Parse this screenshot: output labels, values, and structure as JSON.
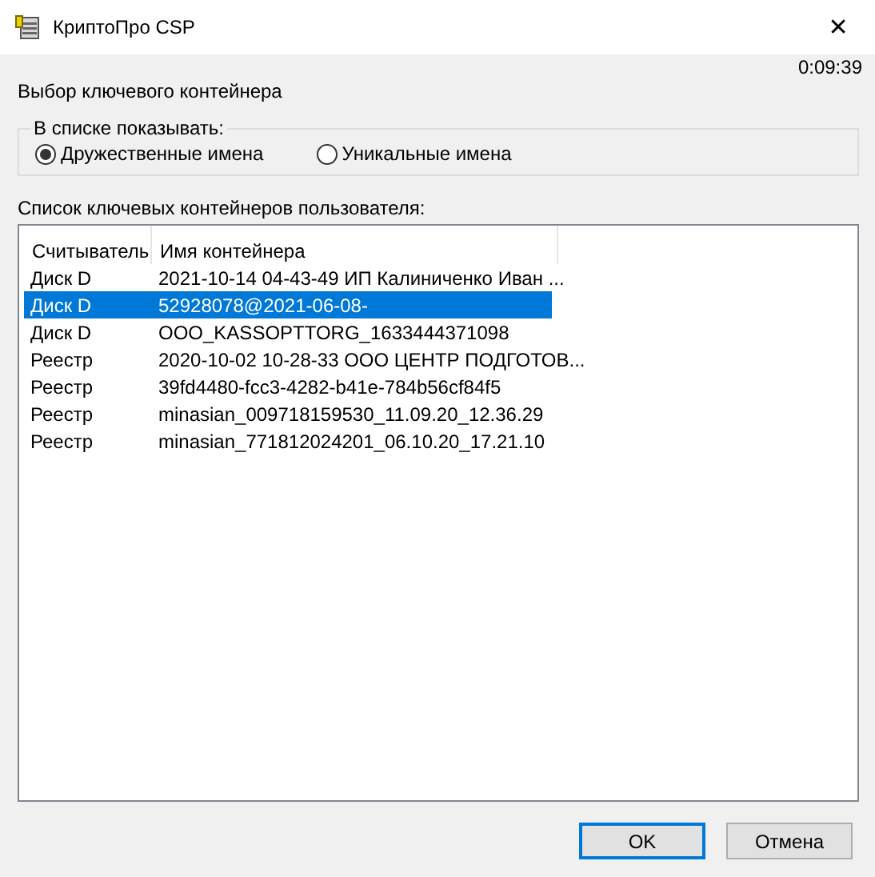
{
  "window": {
    "title": "КриптоПро CSP",
    "close": "✕"
  },
  "timer": "0:09:39",
  "heading": "Выбор ключевого контейнера",
  "show_group": {
    "label": "В списке показывать:",
    "options": [
      {
        "label": "Дружественные имена",
        "selected": true
      },
      {
        "label": "Уникальные имена",
        "selected": false
      }
    ]
  },
  "list_label": "Список ключевых контейнеров пользователя:",
  "table": {
    "columns": [
      "Считыватель",
      "Имя контейнера"
    ],
    "rows": [
      {
        "reader": "Диск D",
        "name": "2021-10-14 04-43-49 ИП Калиниченко Иван ...",
        "selected": false
      },
      {
        "reader": "Диск D",
        "name": "52928078@2021-06-08-",
        "selected": true
      },
      {
        "reader": "Диск D",
        "name": "OOO_KASSOPTTORG_1633444371098",
        "selected": false
      },
      {
        "reader": "Реестр",
        "name": "2020-10-02 10-28-33 ООО ЦЕНТР ПОДГОТОВ...",
        "selected": false
      },
      {
        "reader": "Реестр",
        "name": "39fd4480-fcc3-4282-b41e-784b56cf84f5",
        "selected": false
      },
      {
        "reader": "Реестр",
        "name": "minasian_009718159530_11.09.20_12.36.29",
        "selected": false
      },
      {
        "reader": "Реестр",
        "name": "minasian_771812024201_06.10.20_17.21.10",
        "selected": false
      }
    ]
  },
  "buttons": [
    {
      "label": "OK",
      "default": true
    },
    {
      "label": "Отмена",
      "default": false
    }
  ]
}
